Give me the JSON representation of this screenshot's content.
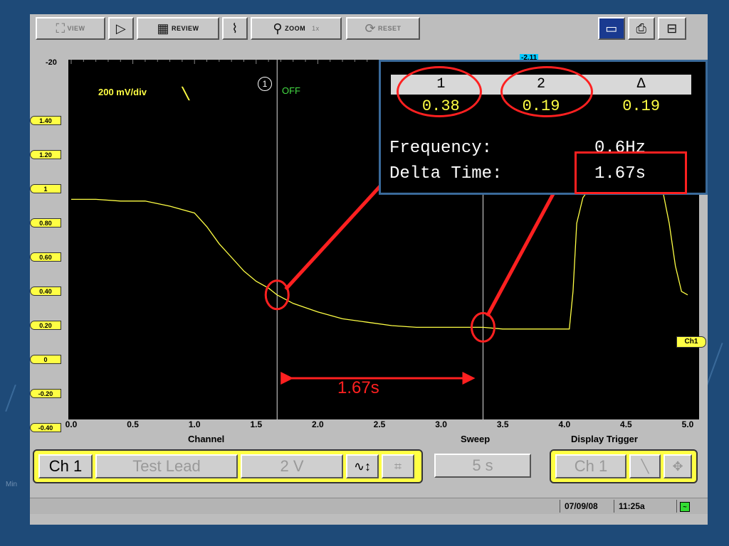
{
  "toolbar": {
    "view": "VIEW",
    "review": "REVIEW",
    "zoom": "ZOOM",
    "zoom_level": "1x",
    "reset": "RESET"
  },
  "scope": {
    "top_limit": "-20",
    "scale": "200 mV/div",
    "cursor1_label": "1",
    "off_label": "OFF",
    "ch_marker": "Ch1",
    "trigger_value": "-2.11",
    "y_labels": [
      "1.40",
      "1.20",
      "1",
      "0.80",
      "0.60",
      "0.40",
      "0.20",
      "0",
      "-0.20",
      "-0.40"
    ],
    "x_labels": [
      "0.0",
      "0.5",
      "1.0",
      "1.5",
      "2.0",
      "2.5",
      "3.0",
      "3.5",
      "4.0",
      "4.5",
      "5.0"
    ]
  },
  "readout": {
    "col1": "1",
    "col2": "2",
    "col3": "Δ",
    "val1": "0.38",
    "val2": "0.19",
    "val3": "0.19",
    "freq_label": "Frequency:",
    "freq_value": "0.6Hz",
    "delta_label": "Delta Time:",
    "delta_value": "1.67s"
  },
  "annotation": {
    "span_label": "1.67s"
  },
  "controls": {
    "channel_section": "Channel",
    "sweep_section": "Sweep",
    "display_trigger_section": "Display Trigger",
    "channel_btn": "Ch 1",
    "lead_btn": "Test Lead",
    "volts_btn": "2 V",
    "sweep_btn": "5 s",
    "trigger_ch_btn": "Ch 1"
  },
  "status": {
    "date": "07/09/08",
    "time": "11:25a"
  },
  "colors": {
    "trace": "#ffff44",
    "annotation": "#ff2020",
    "background": "#1e4a78"
  },
  "chart_data": {
    "type": "line",
    "x_unit": "s",
    "x": [
      0,
      0.2,
      0.4,
      0.6,
      0.8,
      1.0,
      1.1,
      1.2,
      1.3,
      1.4,
      1.5,
      1.6,
      1.67,
      1.8,
      2.0,
      2.2,
      2.4,
      2.6,
      2.8,
      3.0,
      3.2,
      3.34,
      3.5,
      3.7,
      3.9,
      4.04,
      4.07,
      4.1,
      4.15,
      4.2,
      4.3,
      4.5,
      4.7,
      4.8,
      4.85,
      4.9,
      4.95,
      5.0
    ],
    "values": [
      0.94,
      0.94,
      0.93,
      0.93,
      0.9,
      0.86,
      0.78,
      0.68,
      0.6,
      0.52,
      0.46,
      0.42,
      0.38,
      0.33,
      0.28,
      0.24,
      0.22,
      0.2,
      0.19,
      0.19,
      0.19,
      0.19,
      0.18,
      0.18,
      0.18,
      0.18,
      0.4,
      0.8,
      0.95,
      1.0,
      1.02,
      1.02,
      1.02,
      0.98,
      0.8,
      0.55,
      0.4,
      0.38
    ],
    "xlim": [
      0,
      5
    ],
    "ylim": [
      -0.4,
      1.5
    ],
    "cursors": [
      1.67,
      3.34
    ],
    "ylabel": "",
    "xlabel": ""
  }
}
